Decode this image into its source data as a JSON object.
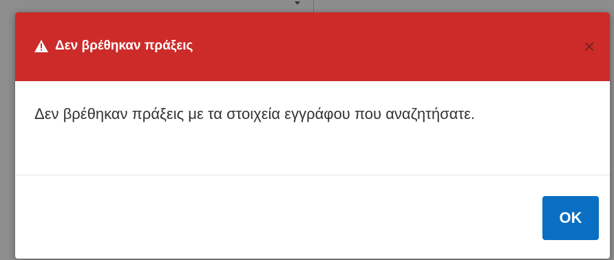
{
  "dialog": {
    "title": "Δεν βρέθηκαν πράξεις",
    "title_icon": "warning-triangle-icon",
    "close_icon": "close-icon",
    "close_glyph": "×",
    "message": "Δεν βρέθηκαν πράξεις με τα στοιχεία εγγράφου που αναζητήσατε.",
    "ok_label": "OK"
  },
  "colors": {
    "header_background": "#cd2a2a",
    "button_background": "#0a6fc2",
    "text": "#333333"
  }
}
